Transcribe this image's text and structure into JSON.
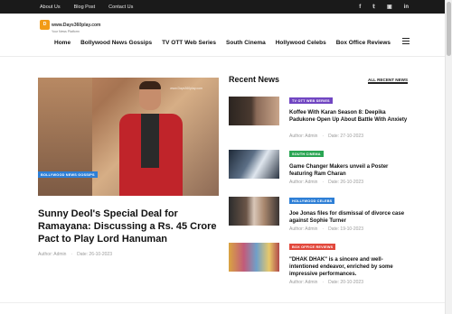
{
  "topbar": {
    "links": [
      "About Us",
      "Blog Post",
      "Contact Us"
    ],
    "social_icons": [
      "facebook-icon",
      "twitter-icon",
      "instagram-icon",
      "linkedin-icon"
    ]
  },
  "logo": {
    "name": "www.Days360play.com",
    "tagline": "Your News Platform",
    "mark": "D"
  },
  "nav": {
    "items": [
      "Home",
      "Bollywood News Gossips",
      "TV OTT Web Series",
      "South Cinema",
      "Hollywood Celebs",
      "Box Office Reviews"
    ]
  },
  "feature": {
    "category": "BOLLYWOOD NEWS GOSSIPS",
    "category_color": "#2e7fd6",
    "watermark": "www.Days360play.com",
    "title": "Sunny Deol's Special Deal for Ramayana: Discussing a Rs. 45 Crore Pact to Play Lord Hanuman",
    "author": "Author: Admin",
    "date": "Date: 26-10-2023"
  },
  "recent": {
    "heading": "Recent News",
    "all_label": "ALL RECENT NEWS",
    "items": [
      {
        "category": "TV OTT WEB SERIES",
        "color": "#7146c2",
        "title": "Koffee With Karan Season 8: Deepika Padukone Open Up About Battle With Anxiety",
        "author": "Author: Admin",
        "date": "Date: 27-10-2023"
      },
      {
        "category": "SOUTH CINEMA",
        "color": "#2aa553",
        "title": "Game Changer Makers unveil a Poster featuring Ram Charan",
        "author": "Author: Admin",
        "date": "Date: 26-10-2023"
      },
      {
        "category": "HOLLYWOOD CELEBS",
        "color": "#2e7fd6",
        "title": "Joe Jonas files for dismissal of divorce case against Sophie Turner",
        "author": "Author: Admin",
        "date": "Date: 19-10-2023"
      },
      {
        "category": "BOX OFFICE REVIEWS",
        "color": "#e2483c",
        "title": "\"DHAK DHAK\" is a sincere and well-intentioned endeavor, enriched by some impressive performances.",
        "author": "Author: Admin",
        "date": "Date: 20-10-2023"
      }
    ]
  }
}
